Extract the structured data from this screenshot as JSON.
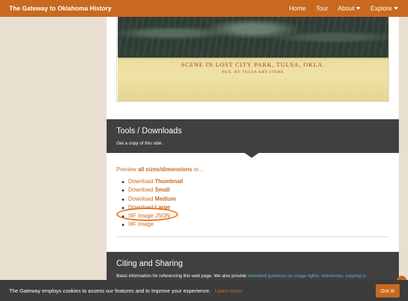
{
  "navbar": {
    "brand": "The Gateway to Oklahoma History",
    "items": [
      {
        "label": "Home",
        "dropdown": false
      },
      {
        "label": "Tour",
        "dropdown": false
      },
      {
        "label": "About",
        "dropdown": true
      },
      {
        "label": "Explore",
        "dropdown": true
      }
    ]
  },
  "postcard": {
    "caption": "SCENE IN LOST CITY PARK, TULSA, OKLA.",
    "publisher": "PUB. BY TULSA ART STORE"
  },
  "tools": {
    "title": "Tools / Downloads",
    "subtitle": "Get a copy of this side ."
  },
  "preview": {
    "prefix": "Preview",
    "link": "all sizes/dimensions",
    "suffix": "or..."
  },
  "downloads": [
    {
      "prefix": "Download",
      "bold": "Thumbnail"
    },
    {
      "prefix": "Download",
      "bold": "Small"
    },
    {
      "prefix": "Download",
      "bold": "Medium"
    },
    {
      "prefix": "Download",
      "bold": "Large"
    },
    {
      "prefix": "IIIF Image JSON",
      "bold": ""
    },
    {
      "prefix": "IIIF Image",
      "bold": ""
    }
  ],
  "cite": {
    "title": "Citing and Sharing",
    "text": "Basic information for referencing this web page. We also provide",
    "link": "extended guidance on usage rights, references, copying or"
  },
  "cookie": {
    "message": "The Gateway employs cookies to assess our features and to improve your experience.",
    "learn_more": "Learn more.",
    "button": "Got it!"
  },
  "colors": {
    "accent": "#c8691f",
    "band": "#404040",
    "highlight_circle": "#e8731a"
  }
}
